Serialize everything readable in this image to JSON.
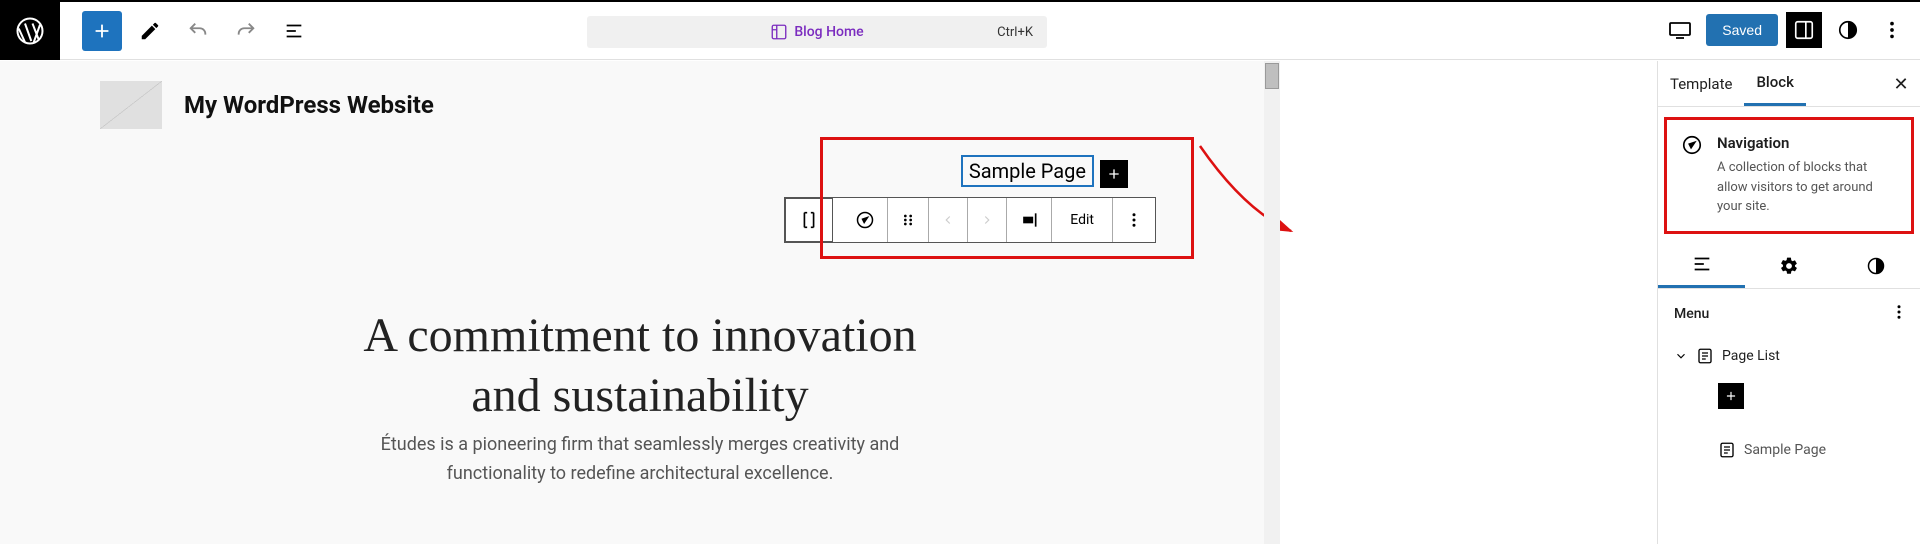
{
  "topbar": {
    "shortcut": "Ctrl+K",
    "doc_title": "Blog Home",
    "saved_label": "Saved"
  },
  "site": {
    "title": "My WordPress Website",
    "nav_item": "Sample Page"
  },
  "toolbar": {
    "edit_label": "Edit"
  },
  "headline": {
    "line1": "A commitment to innovation",
    "line2": "and sustainability"
  },
  "subtext": {
    "line1": "Études is a pioneering firm that seamlessly merges creativity and",
    "line2": "functionality to redefine architectural excellence."
  },
  "panel": {
    "tabs": {
      "template": "Template",
      "block": "Block"
    },
    "block": {
      "name": "Navigation",
      "desc": "A collection of blocks that allow visitors to get around your site."
    },
    "menu_label": "Menu",
    "tree": {
      "page_list": "Page List",
      "sample_page": "Sample Page"
    }
  }
}
